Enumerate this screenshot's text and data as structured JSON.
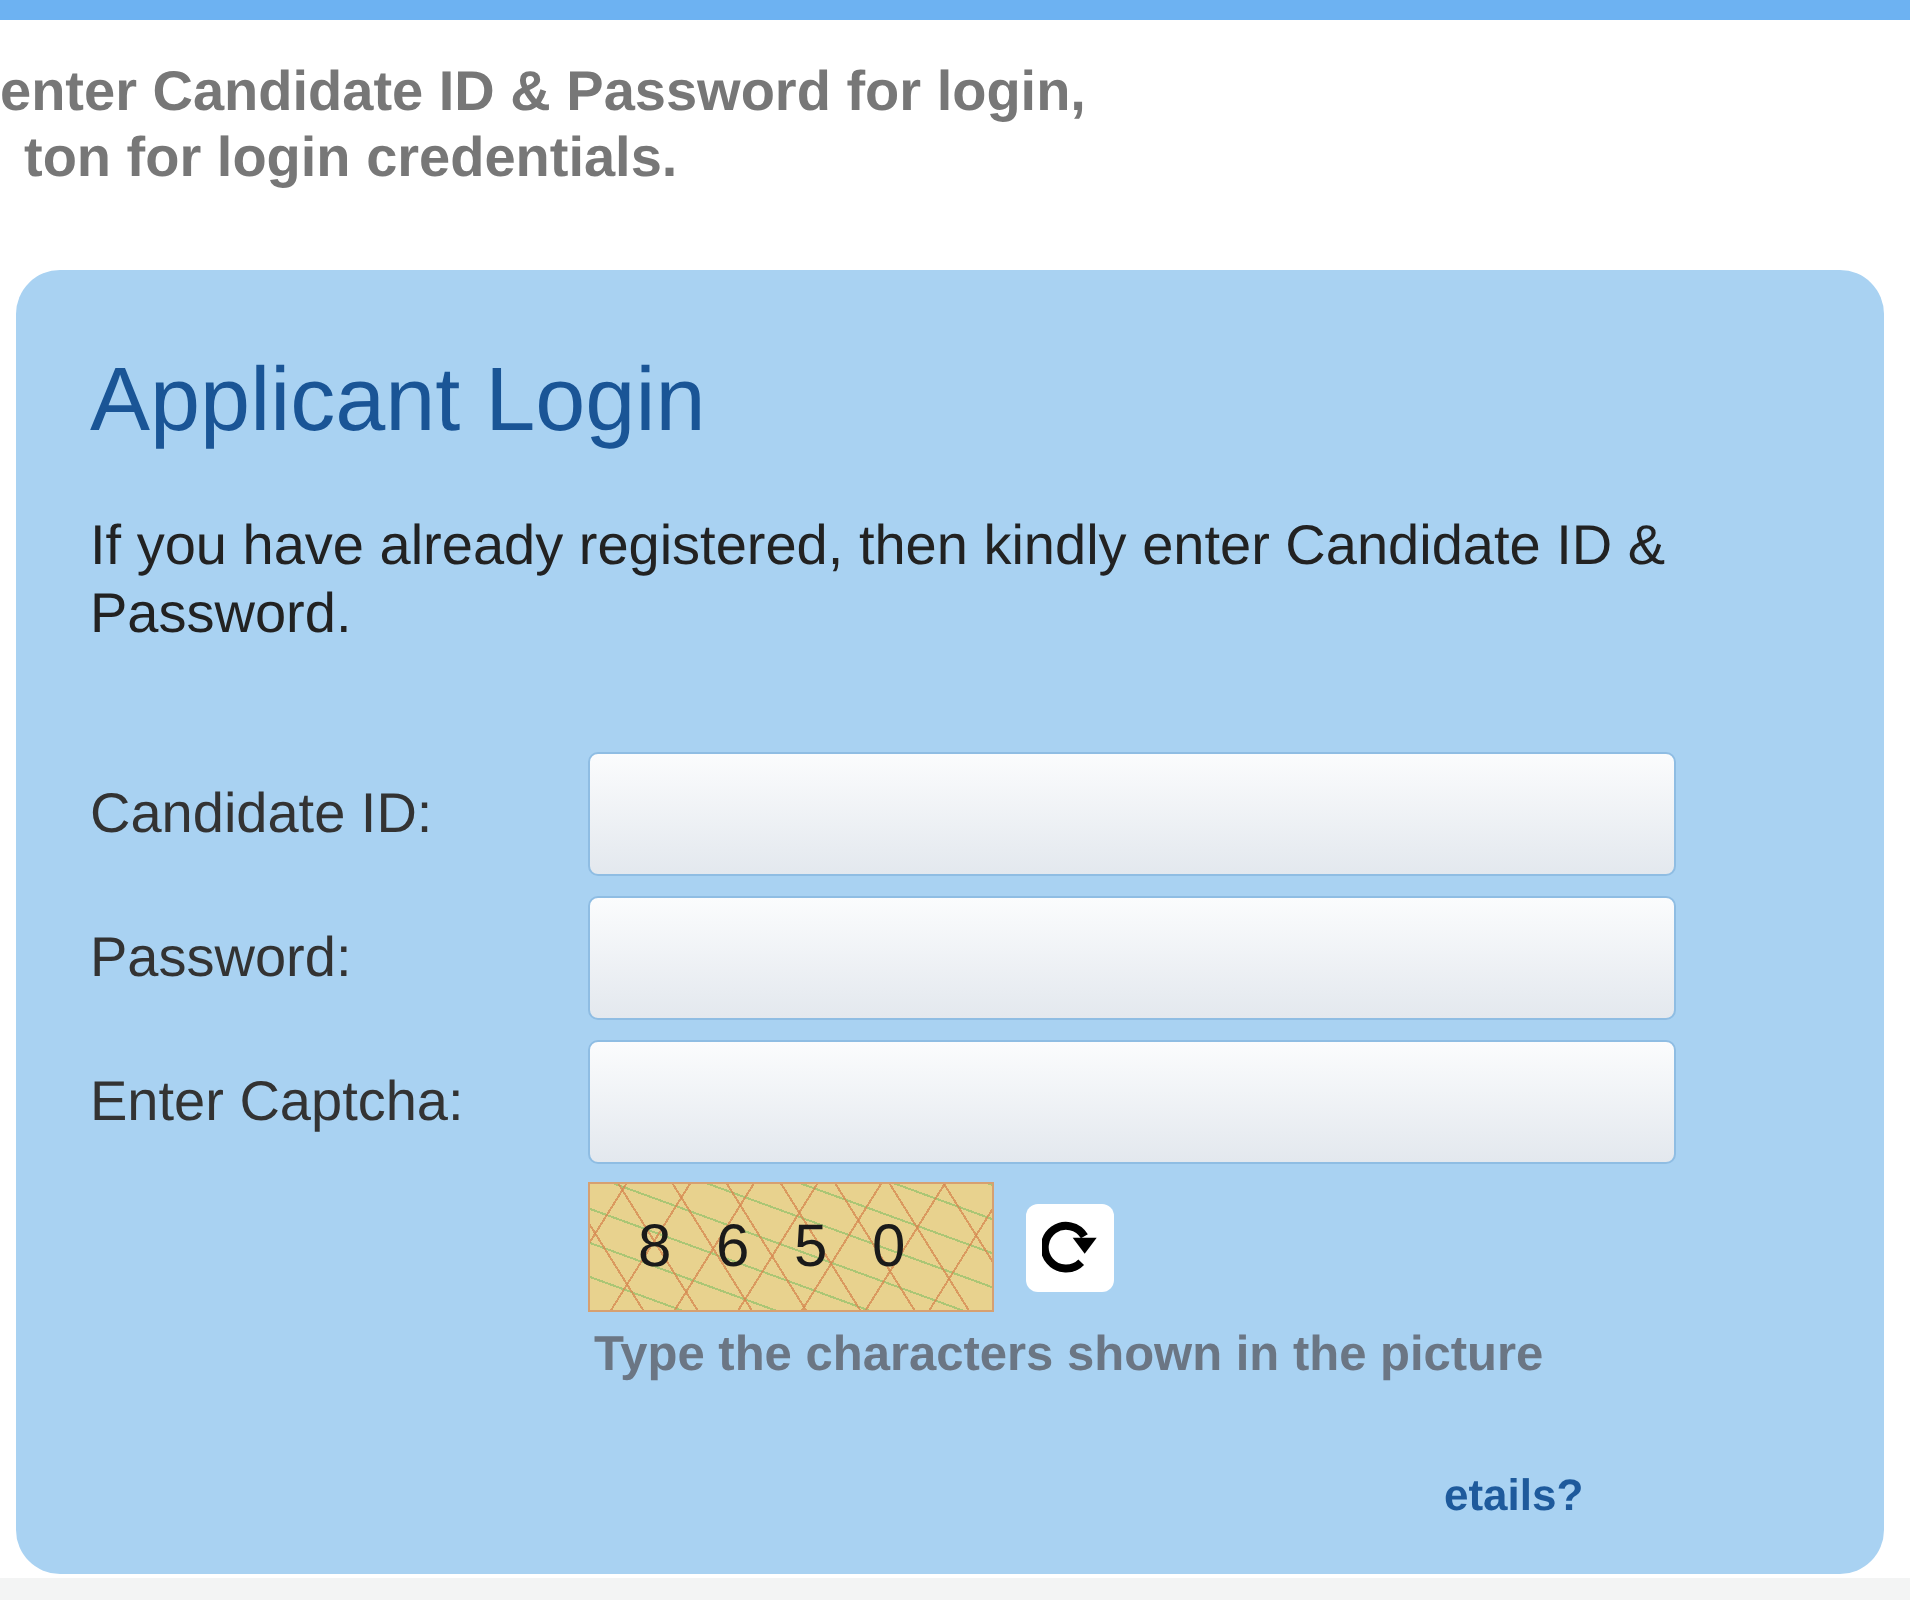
{
  "instructions": [
    "enter Candidate ID & Password for login,",
    "ton for login credentials."
  ],
  "login": {
    "title": "Applicant Login",
    "intro": "If you have already registered, then kindly enter Candidate ID & Password.",
    "fields": [
      {
        "label": "Candidate ID:"
      },
      {
        "label": "Password:"
      },
      {
        "label": "Enter Captcha:"
      }
    ],
    "captcha": {
      "text": "8 6 5 0",
      "hint": "Type the characters shown in the picture"
    },
    "link": "etails?"
  }
}
